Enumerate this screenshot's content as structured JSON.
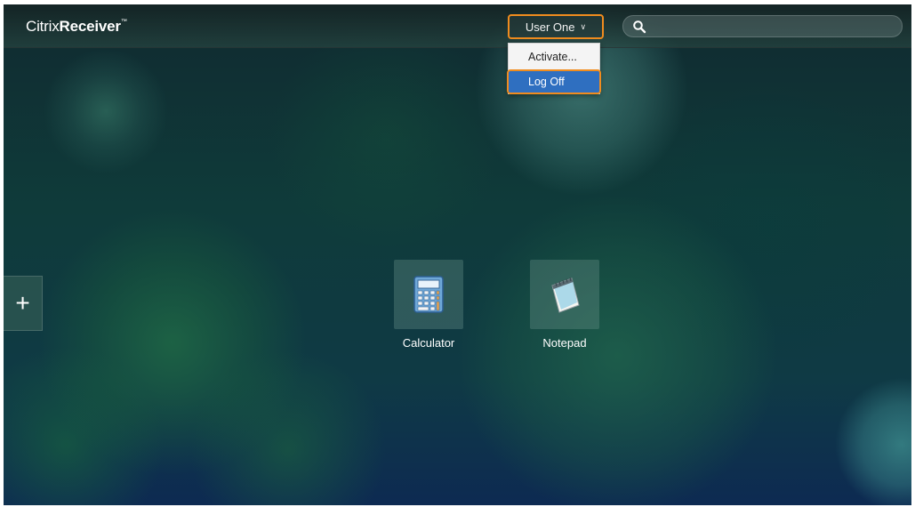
{
  "header": {
    "brand_light": "Citrix",
    "brand_bold": "Receiver",
    "brand_tm": "™",
    "user_menu_label": "User One",
    "search_placeholder": ""
  },
  "user_menu": {
    "items": [
      {
        "label": "Activate..."
      },
      {
        "label": "Log Off",
        "highlighted": true
      }
    ]
  },
  "apps": [
    {
      "label": "Calculator",
      "icon": "calculator-icon"
    },
    {
      "label": "Notepad",
      "icon": "notepad-icon"
    }
  ],
  "add_button": {
    "label": "+"
  },
  "colors": {
    "highlight_outline": "#f08c1e",
    "selected_menu_bg": "#2f6fc0"
  }
}
